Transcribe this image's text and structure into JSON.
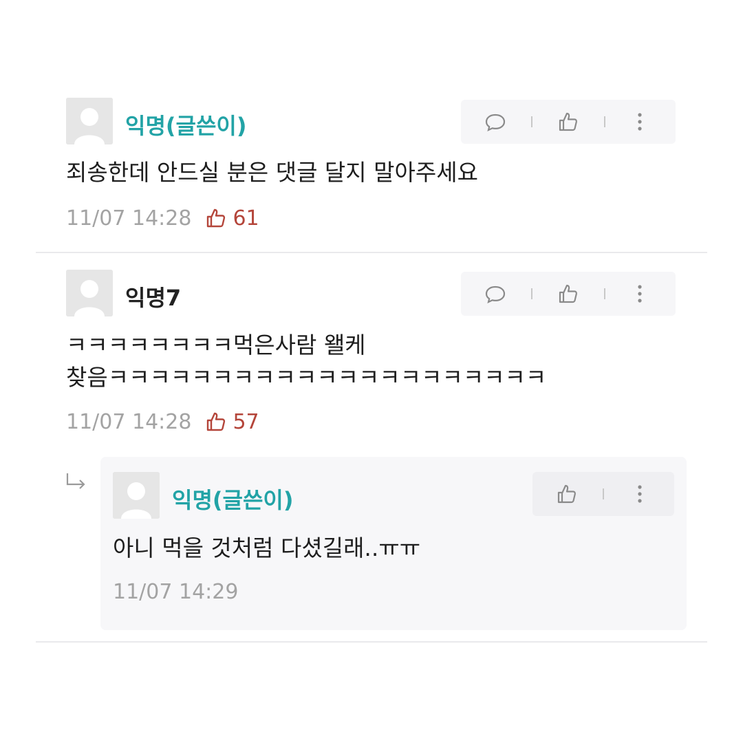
{
  "comments": [
    {
      "author": "익명(글쓴이)",
      "is_op": true,
      "text": "죄송한데 안드실 분은 댓글 달지 말아주세요",
      "time": "11/07 14:28",
      "likes": "61"
    },
    {
      "author": "익명7",
      "is_op": false,
      "text_lines": [
        "ㅋㅋㅋㅋㅋㅋㅋㅋ먹은사람 왤케",
        "찾음ㅋㅋㅋㅋㅋㅋㅋㅋㅋㅋㅋㅋㅋㅋㅋㅋㅋㅋㅋㅋㅋ"
      ],
      "time": "11/07 14:28",
      "likes": "57"
    }
  ],
  "reply": {
    "author": "익명(글쓴이)",
    "is_op": true,
    "text": "아니 먹을 것처럼 다셨길래..ㅠㅠ",
    "time": "11/07 14:29"
  },
  "icons": {
    "comment": "speech-bubble-icon",
    "like": "thumbs-up-icon",
    "more": "more-vertical-icon",
    "reply_arrow": "reply-arrow-icon",
    "avatar": "default-avatar-icon"
  },
  "colors": {
    "op_author": "#22a3a6",
    "like_count": "#b4453a",
    "timestamp": "#a3a3a3",
    "action_bar_bg": "#f6f6f8"
  }
}
